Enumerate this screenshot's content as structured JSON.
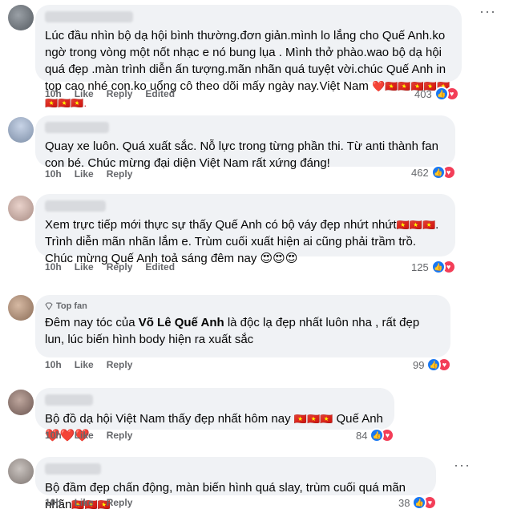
{
  "comments": [
    {
      "text": "Lúc đầu nhìn bộ dạ hội bình thường.đơn giản.mình lo lắng cho Quế Anh.ko ngờ trong vòng một nốt nhạc e nó bung lụa . Mình thở phào.wao bộ dạ hội quá đẹp .màn trình diễn ấn tượng.mãn nhãn quá tuyệt vời.chúc Quế Anh in top cao nhé con.ko uổng cô theo dõi mấy ngày nay.Việt Nam ",
      "emoji": "❤️🇻🇳🇻🇳🇻🇳🇻🇳🇻🇳🇻🇳🇻🇳🇻🇳.",
      "time": "10h",
      "like": "Like",
      "reply": "Reply",
      "edited": "Edited",
      "reactions": "403"
    },
    {
      "text": "Quay xe luôn. Quá xuất sắc. Nỗ lực trong từng phần thi. Từ anti thành fan con bé. Chúc mừng đại diện Việt Nam rất xứng đáng!",
      "emoji": "",
      "time": "10h",
      "like": "Like",
      "reply": "Reply",
      "edited": "",
      "reactions": "462"
    },
    {
      "text": "Xem trực tiếp mới thực sự thấy Quế Anh có bộ váy đẹp nhứt nhứt",
      "emoji": "🇻🇳🇻🇳🇻🇳",
      "text2": ". Trình diễn mãn nhãn lắm e. Trùm cuối xuất hiện ai cũng phải trầm trồ. Chúc mừng Quế Anh toả sáng đêm nay ",
      "emoji2": "😍😍😍",
      "time": "10h",
      "like": "Like",
      "reply": "Reply",
      "edited": "Edited",
      "reactions": "125"
    },
    {
      "badge": "Top fan",
      "text": "Đêm nay tóc của ",
      "bold": "Võ Lê Quế Anh",
      "text2": " là độc lạ đẹp nhất luôn nha , rất đẹp lun, lúc biến hình body hiện ra xuất sắc",
      "time": "10h",
      "like": "Like",
      "reply": "Reply",
      "edited": "",
      "reactions": "99"
    },
    {
      "text": "Bộ đồ dạ hội Việt Nam thấy đẹp nhất hôm nay ",
      "emoji": "🇻🇳🇻🇳🇻🇳",
      "text2": " Quế Anh ",
      "emoji2": "❤️❤️❤️",
      "time": "10h",
      "like": "Like",
      "reply": "Reply",
      "edited": "",
      "reactions": "84"
    },
    {
      "text": "Bộ đầm đẹp chấn động, màn biến hình quá slay, trùm cuối quá mãn nhãn",
      "emoji": "🇻🇳🇻🇳🇻🇳",
      "time": "10h",
      "like": "Like",
      "reply": "Reply",
      "edited": "",
      "reactions": "38"
    }
  ],
  "icons": {
    "like": "like-reaction-icon",
    "love": "love-reaction-icon",
    "more": "more-options-icon",
    "topfan": "diamond-icon"
  },
  "colors": {
    "bubble": "#f0f2f5",
    "meta": "#65676b",
    "like": "#1877f2",
    "love": "#f33e58",
    "flag": "#d8262c"
  }
}
